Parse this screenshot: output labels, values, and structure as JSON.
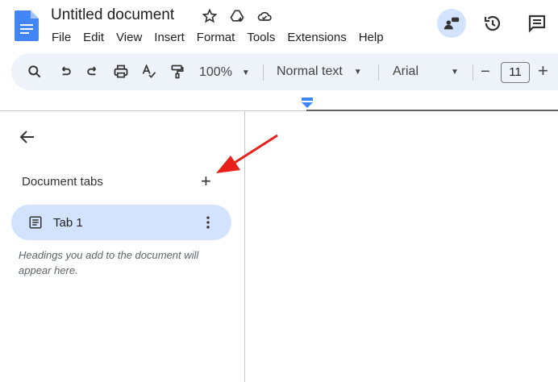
{
  "header": {
    "title": "Untitled document",
    "menu": [
      "File",
      "Edit",
      "View",
      "Insert",
      "Format",
      "Tools",
      "Extensions",
      "Help"
    ]
  },
  "toolbar": {
    "zoom": "100%",
    "style": "Normal text",
    "font": "Arial",
    "font_size": "11",
    "minus": "−",
    "plus": "+"
  },
  "sidebar": {
    "section_title": "Document tabs",
    "add": "+",
    "tab_label": "Tab 1",
    "hint": "Headings you add to the document will appear here."
  },
  "colors": {
    "accent": "#1a73e8",
    "tab_bg": "#d3e3fd",
    "arrow": "#e8201a"
  }
}
